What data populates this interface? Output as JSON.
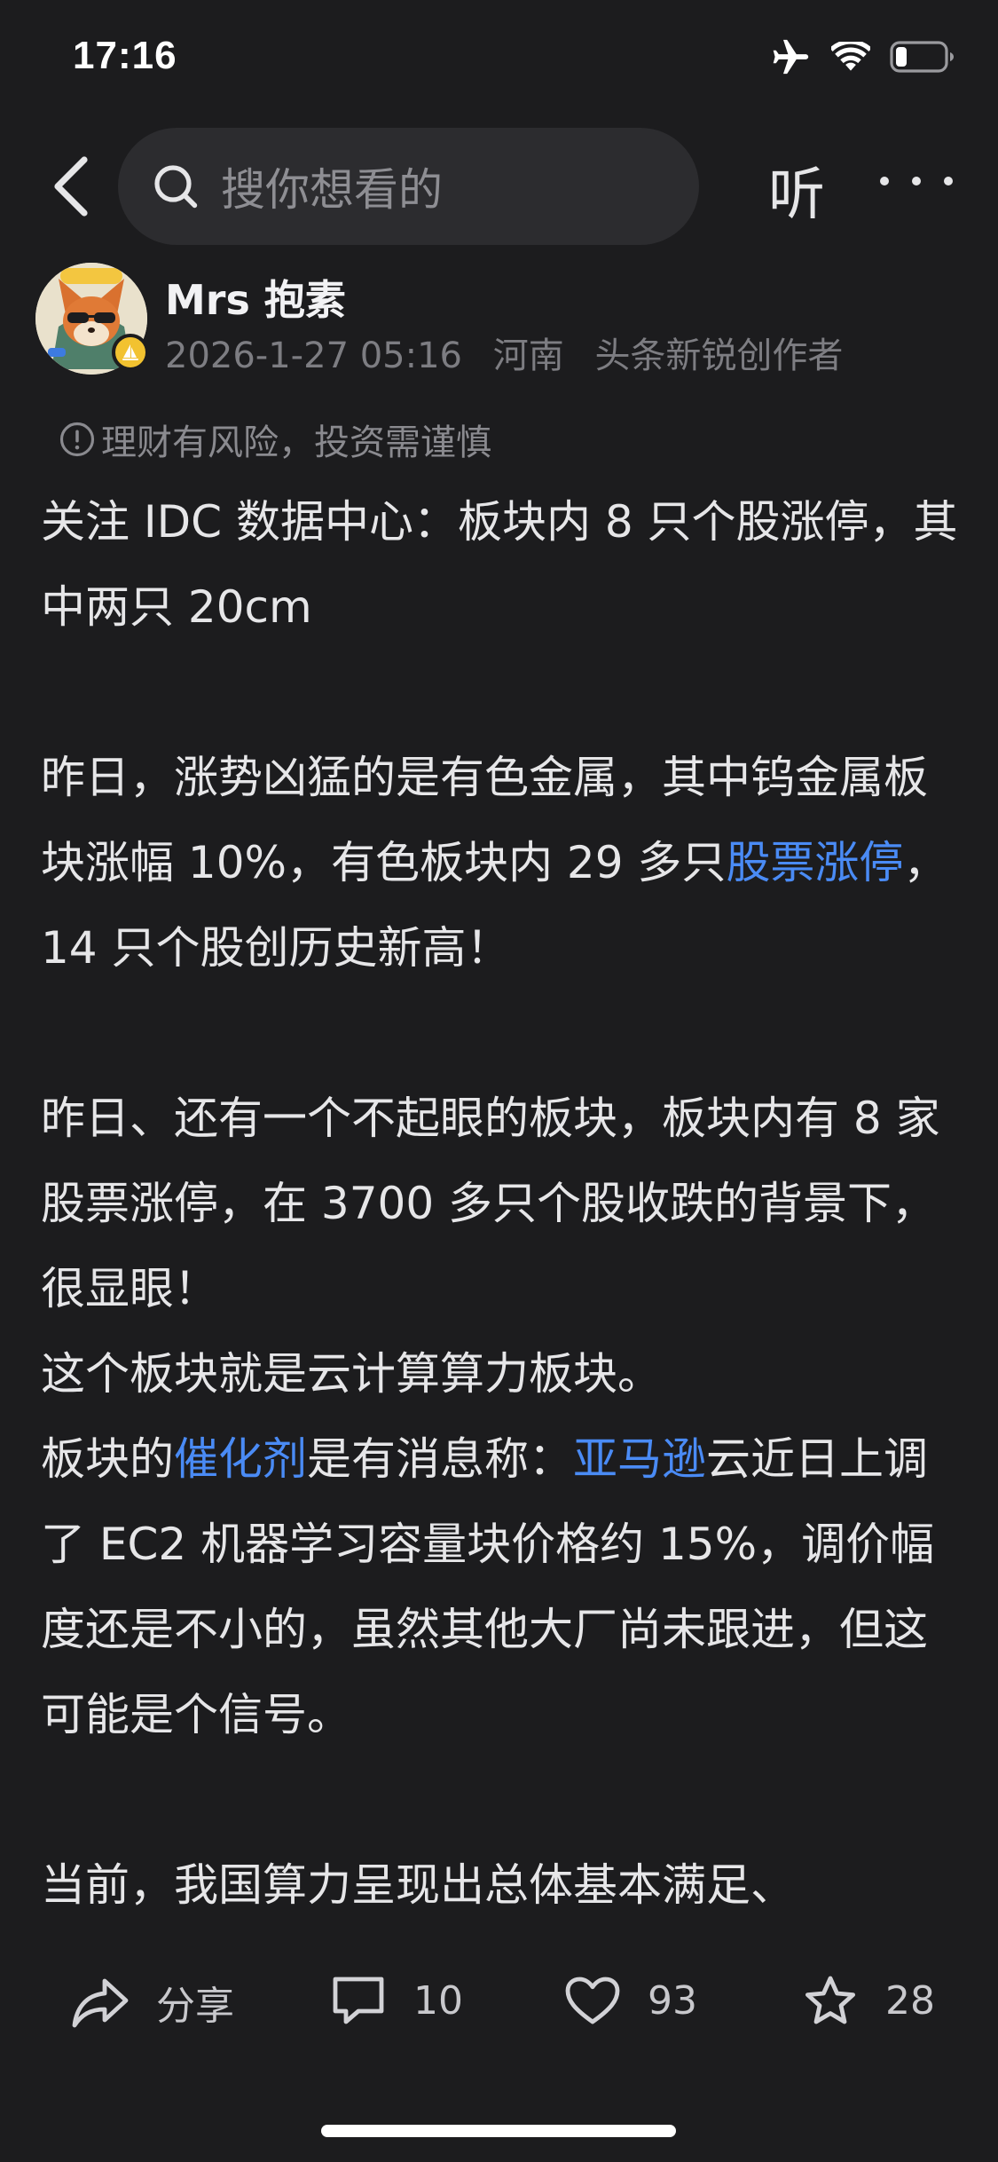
{
  "status_bar": {
    "time": "17:16"
  },
  "nav": {
    "search_placeholder": "搜你想看的",
    "listen_label": "听"
  },
  "author": {
    "name": "Mrs 抱素",
    "date": "2026-1-27 05:16",
    "location": "河南",
    "title": "头条新锐创作者"
  },
  "disclaimer": "理财有风险，投资需谨慎",
  "article": {
    "p1": "关注 IDC 数据中心：板块内 8 只个股涨停，其中两只 20cm",
    "p2_a": "昨日，涨势凶猛的是有色金属，其中钨金属板块涨幅 10%，有色板块内 29 多只",
    "p2_link": "股票涨停",
    "p2_b": "，14 只个股创历史新高！",
    "p3_a": "昨日、还有一个不起眼的板块，板块内有 8 家股票涨停，在 3700 多只个股收跌的背景下，很显眼！",
    "p3_b": "这个板块就是云计算算力板块。",
    "p3_c1": "板块的",
    "p3_link1": "催化剂",
    "p3_c2": "是有消息称：",
    "p3_link2": "亚马逊",
    "p3_c3": "云近日上调了 EC2 机器学习容量块价格约 15%，调价幅度还是不小的，虽然其他大厂尚未跟进，但这可能是个信号。",
    "p4": "当前，我国算力呈现出总体基本满足、"
  },
  "actions": {
    "share_label": "分享",
    "comment_count": "10",
    "like_count": "93",
    "favorite_count": "28"
  },
  "colors": {
    "background": "#1c1c1e",
    "link": "#4a8bf5",
    "badge": "#f2c230"
  }
}
